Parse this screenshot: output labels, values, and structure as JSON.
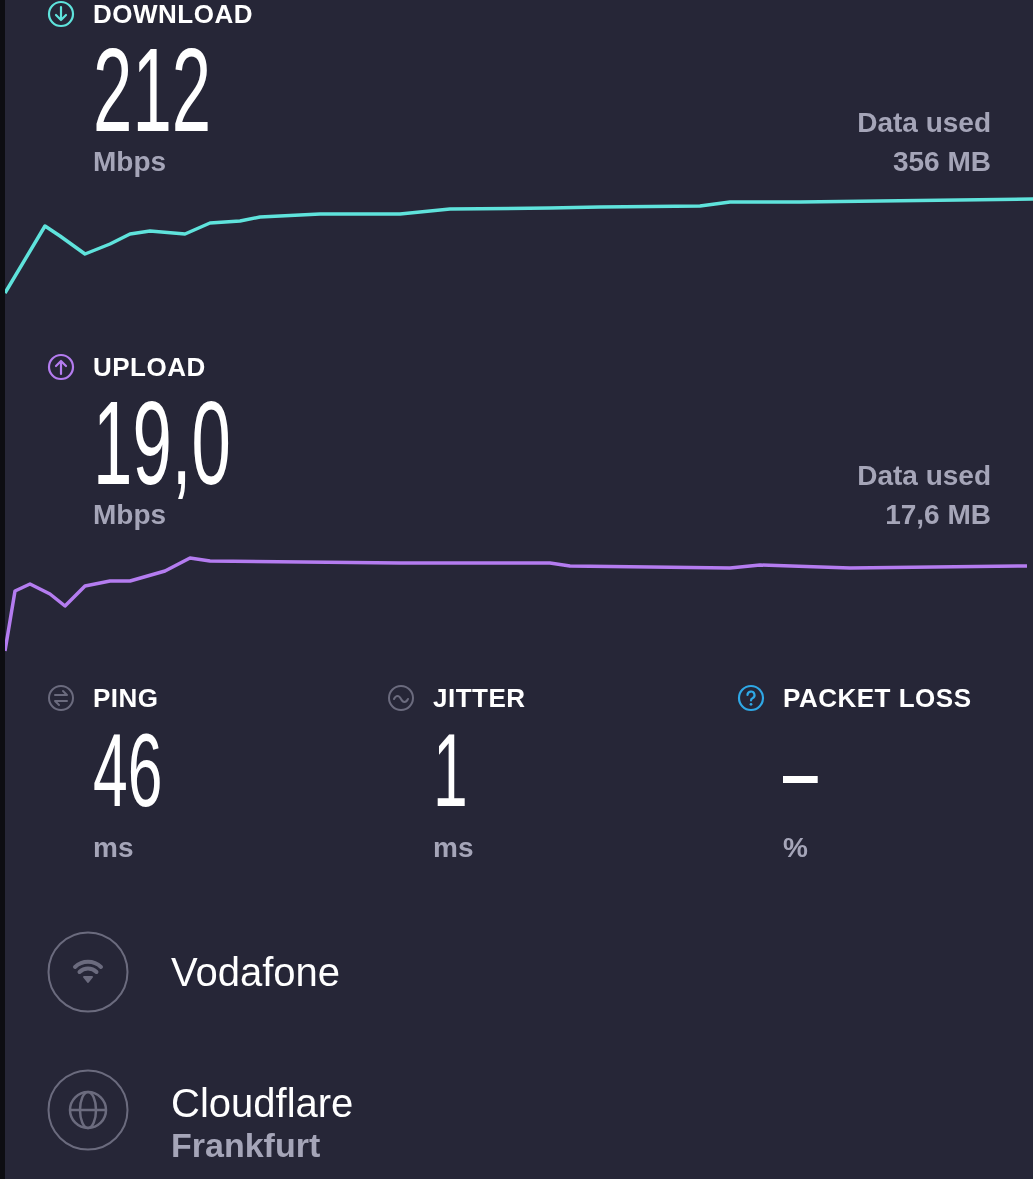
{
  "speeds": [
    {
      "kind": "download",
      "label": "DOWNLOAD",
      "value": "212",
      "unit": "Mbps",
      "data_label": "Data used",
      "data_value": "356 MB",
      "color": "#5fe3dc"
    },
    {
      "kind": "upload",
      "label": "UPLOAD",
      "value": "19,0",
      "unit": "Mbps",
      "data_label": "Data used",
      "data_value": "17,6 MB",
      "color": "#b47cf0"
    }
  ],
  "metrics": [
    {
      "kind": "ping",
      "label": "PING",
      "value": "46",
      "unit": "ms"
    },
    {
      "kind": "jitter",
      "label": "JITTER",
      "value": "1",
      "unit": "ms"
    },
    {
      "kind": "packet_loss",
      "label": "PACKET LOSS",
      "value": "–",
      "unit": "%"
    }
  ],
  "servers": [
    {
      "kind": "provider",
      "name": "Vodafone"
    },
    {
      "kind": "server",
      "name": "Cloudflare",
      "location": "Frankfurt"
    }
  ]
}
